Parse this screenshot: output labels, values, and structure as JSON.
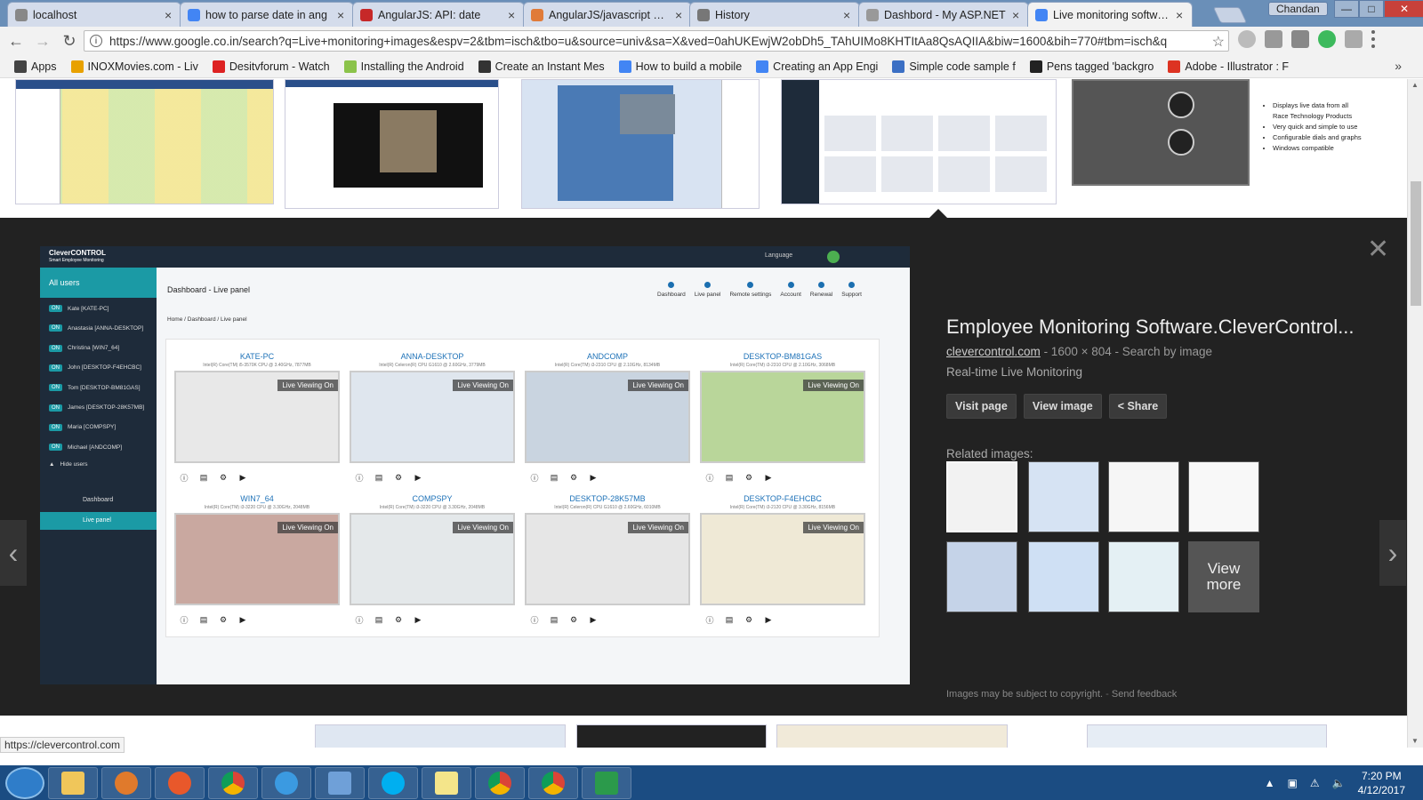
{
  "browser": {
    "tabs": [
      {
        "title": "localhost",
        "color": "#888"
      },
      {
        "title": "how to parse date in ang",
        "color": "#4285f4"
      },
      {
        "title": "AngularJS: API: date",
        "color": "#c62828"
      },
      {
        "title": "AngularJS/javascript con",
        "color": "#e07b39"
      },
      {
        "title": "History",
        "color": "#777"
      },
      {
        "title": "Dashbord - My ASP.NET",
        "color": "#999"
      },
      {
        "title": "Live monitoring software",
        "color": "#4285f4"
      }
    ],
    "user_name": "Chandan",
    "url": "https://www.google.co.in/search?q=Live+monitoring+images&espv=2&tbm=isch&tbo=u&source=univ&sa=X&ved=0ahUKEwjW2obDh5_TAhUIMo8KHTItAa8QsAQIIA&biw=1600&bih=770#tbm=isch&q",
    "bookmarks": [
      {
        "label": "Apps",
        "color": "#444"
      },
      {
        "label": "INOXMovies.com - Liv",
        "color": "#e8a100"
      },
      {
        "label": "Desitvforum - Watch",
        "color": "#d22"
      },
      {
        "label": "Installing the Android",
        "color": "#8bc34a"
      },
      {
        "label": "Create an Instant Mes",
        "color": "#333"
      },
      {
        "label": "How to build a mobile",
        "color": "#4285f4"
      },
      {
        "label": "Creating an App Engi",
        "color": "#4285f4"
      },
      {
        "label": "Simple code sample f",
        "color": "#3b6fc4"
      },
      {
        "label": "Pens tagged 'backgro",
        "color": "#222"
      },
      {
        "label": "Adobe - Illustrator : F",
        "color": "#d32"
      }
    ],
    "status_url": "https://clevercontrol.com"
  },
  "preview": {
    "title": "Employee Monitoring Software.CleverControl...",
    "site": "clevercontrol.com",
    "meta": "- 1600 × 804 - Search by image",
    "description": "Real-time Live Monitoring",
    "buttons": {
      "visit": "Visit page",
      "view": "View image",
      "share": "Share"
    },
    "related_label": "Related images:",
    "view_more": "View more",
    "copyright": "Images may be subject to copyright.",
    "feedback": "Send feedback"
  },
  "thumb_captions": [
    "Displays live data from all Race Technology Products",
    "Very quick and simple to use",
    "Configurable dials and graphs",
    "Windows compatible"
  ],
  "clever": {
    "logo": "CleverCONTROL",
    "logo_sub": "Smart Employee Monitoring",
    "language": "Language",
    "all_users": "All users",
    "users": [
      "Kate [KATE-PC]",
      "Anastasia [ANNA-DESKTOP]",
      "Christina [WIN7_64]",
      "John [DESKTOP-F4EHCBC]",
      "Tom [DESKTOP-BM81GAS]",
      "James [DESKTOP-28K57MB]",
      "Maria [COMPSPY]",
      "Michael [ANDCOMP]"
    ],
    "on_label": "ON",
    "hide_users": "Hide users",
    "nav": [
      "Dashboard",
      "Live panel"
    ],
    "page_title": "Dashboard - Live panel",
    "topnav": [
      "Dashboard",
      "Live panel",
      "Remote settings",
      "Account",
      "Renewal",
      "Support"
    ],
    "crumbs": "Home  /  Dashboard  /  Live panel",
    "live_label": "Live Viewing On",
    "machines": [
      {
        "name": "KATE-PC",
        "spec": "Intel(R) Core(TM) i5-3570K CPU @ 3.40GHz, 7877MB",
        "color": "#e8e8e8"
      },
      {
        "name": "ANNA-DESKTOP",
        "spec": "Intel(R) Celeron(R) CPU G1610 @ 2.60GHz, 3779MB",
        "color": "#dfe6ee"
      },
      {
        "name": "ANDCOMP",
        "spec": "Intel(R) Core(TM) i3-2310 CPU @ 2.10GHz, 8134MB",
        "color": "#c9d4e0"
      },
      {
        "name": "DESKTOP-BM81GAS",
        "spec": "Intel(R) Core(TM) i3-2310 CPU @ 2.10GHz, 3068MB",
        "color": "#b9d69a"
      },
      {
        "name": "WIN7_64",
        "spec": "Intel(R) Core(TM) i3-3220 CPU @ 3.30GHz, 2048MB",
        "color": "#c9a8a0"
      },
      {
        "name": "COMPSPY",
        "spec": "Intel(R) Core(TM) i3-3220 CPU @ 3.30GHz, 2048MB",
        "color": "#e4e8ea"
      },
      {
        "name": "DESKTOP-28K57MB",
        "spec": "Intel(R) Celeron(R) CPU G1610 @ 2.60GHz, 6010MB",
        "color": "#e6e6e6"
      },
      {
        "name": "DESKTOP-F4EHCBC",
        "spec": "Intel(R) Core(TM) i3-2120 CPU @ 3.30GHz, 8156MB",
        "color": "#efe9d6"
      }
    ]
  },
  "taskbar": {
    "time": "7:20 PM",
    "date": "4/12/2017"
  }
}
